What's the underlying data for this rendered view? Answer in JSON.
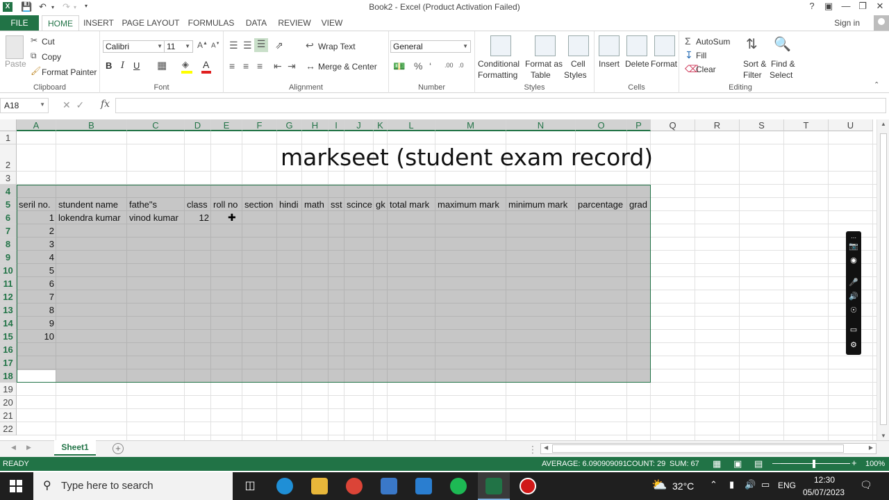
{
  "window": {
    "title": "Book2 - Excel (Product Activation Failed)",
    "help": "?",
    "signin": "Sign in"
  },
  "tabs": [
    "FILE",
    "HOME",
    "INSERT",
    "PAGE LAYOUT",
    "FORMULAS",
    "DATA",
    "REVIEW",
    "VIEW"
  ],
  "active_tab": "HOME",
  "ribbon": {
    "clipboard": {
      "paste": "Paste",
      "cut": "Cut",
      "copy": "Copy",
      "format_painter": "Format Painter",
      "label": "Clipboard"
    },
    "font": {
      "name": "Calibri",
      "size": "11",
      "label": "Font"
    },
    "alignment": {
      "wrap": "Wrap Text",
      "merge": "Merge & Center",
      "label": "Alignment"
    },
    "number": {
      "format": "General",
      "label": "Number"
    },
    "styles": {
      "conditional": "Conditional",
      "conditional2": "Formatting",
      "format_as": "Format as",
      "table": "Table",
      "cell": "Cell",
      "cell_styles": "Styles",
      "label": "Styles"
    },
    "cells": {
      "insert": "Insert",
      "delete": "Delete",
      "format": "Format",
      "label": "Cells"
    },
    "editing": {
      "autosum": "AutoSum",
      "fill": "Fill",
      "clear": "Clear",
      "sort": "Sort &",
      "filter": "Filter",
      "find": "Find &",
      "select": "Select",
      "label": "Editing"
    }
  },
  "formula_bar": {
    "name_box": "A18",
    "fx": "fx",
    "value": ""
  },
  "columns": [
    "A",
    "B",
    "C",
    "D",
    "E",
    "F",
    "G",
    "H",
    "I",
    "J",
    "K",
    "L",
    "M",
    "N",
    "O",
    "P",
    "Q",
    "R",
    "S",
    "T",
    "U"
  ],
  "rows": [
    "1",
    "2",
    "3",
    "4",
    "5",
    "6",
    "7",
    "8",
    "9",
    "10",
    "11",
    "12",
    "13",
    "14",
    "15",
    "16",
    "17",
    "18",
    "19",
    "20",
    "21",
    "22"
  ],
  "sheet": {
    "title": "markseet (student exam record)",
    "headers": [
      "seril no.",
      "stundent name",
      "fathe\"s",
      "class",
      "roll no",
      "section",
      "hindi",
      "math",
      "sst",
      "scince",
      "gk",
      "total mark",
      "maximum mark",
      "minimum mark",
      "parcentage",
      "grad"
    ],
    "row6": {
      "serial": "1",
      "name": "lokendra kumar",
      "father": "vinod kumar",
      "class": "12"
    },
    "serials": [
      "2",
      "3",
      "4",
      "5",
      "6",
      "7",
      "8",
      "9",
      "10"
    ]
  },
  "sheet_tab": "Sheet1",
  "status": {
    "ready": "READY",
    "average": "AVERAGE: 6.090909091",
    "count": "COUNT: 29",
    "sum": "SUM: 67",
    "zoom": "100%"
  },
  "taskbar": {
    "search_placeholder": "Type here to search",
    "weather": "32°C",
    "lang": "ENG",
    "time": "12:30",
    "date": "05/07/2023"
  },
  "colors": {
    "excel_green": "#217346",
    "selection": "#9a9a9a"
  }
}
